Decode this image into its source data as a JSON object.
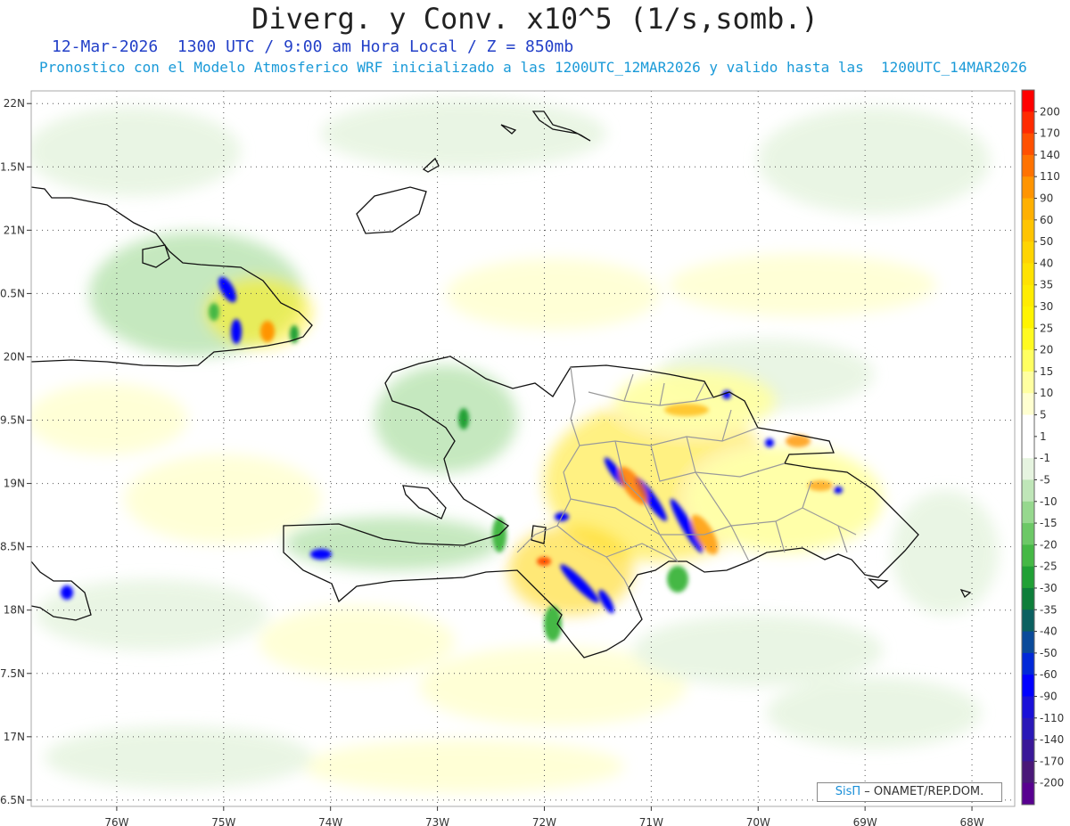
{
  "title": "Diverg. y Conv. x10^5 (1/s,somb.)",
  "subtitle_line1": "12-Mar-2026  1300 UTC / 9:00 am Hora Local / Z = 850mb",
  "subtitle_line2": "Pronostico con el Modelo Atmosferico WRF inicializado a las 1200UTC_12MAR2026 y valido hasta las  1200UTC_14MAR2026",
  "credit": {
    "brand": "SisΠ",
    "text": "– ONAMET/REP.DOM."
  },
  "chart_data": {
    "type": "heatmap",
    "lat_labels": [
      "22N",
      "1.5N",
      "21N",
      "0.5N",
      "20N",
      "9.5N",
      "19N",
      "8.5N",
      "18N",
      "7.5N",
      "17N",
      "6.5N"
    ],
    "lat_values": [
      22,
      21.5,
      21,
      20.5,
      20,
      19.5,
      19,
      18.5,
      18,
      17.5,
      17,
      16.5
    ],
    "lon_labels": [
      "76W",
      "75W",
      "74W",
      "73W",
      "72W",
      "71W",
      "70W",
      "69W",
      "68W"
    ],
    "lon_values": [
      -76,
      -75,
      -74,
      -73,
      -72,
      -71,
      -70,
      -69,
      -68
    ],
    "xlim": [
      -76.8,
      -67.6
    ],
    "ylim": [
      16.45,
      22.1
    ],
    "grid": true,
    "colorbar": {
      "labels": [
        "200",
        "170",
        "140",
        "110",
        "90",
        "60",
        "50",
        "40",
        "35",
        "30",
        "25",
        "20",
        "15",
        "10",
        "5",
        "1",
        "-1",
        "-5",
        "-10",
        "-15",
        "-20",
        "-25",
        "-30",
        "-35",
        "-40",
        "-50",
        "-60",
        "-90",
        "-110",
        "-140",
        "-170",
        "-200"
      ],
      "colors": [
        "#ff0000",
        "#ff2a00",
        "#ff5000",
        "#ff7200",
        "#ff9400",
        "#ffb000",
        "#ffc400",
        "#ffd400",
        "#ffe200",
        "#ffec00",
        "#fff400",
        "#fffa20",
        "#ffff60",
        "#ffffa0",
        "#ffffd0",
        "#ffffff",
        "#ffffff",
        "#e6f4e0",
        "#bfe6b8",
        "#96d88e",
        "#6cc866",
        "#45b845",
        "#20a035",
        "#0e7e3a",
        "#0b6060",
        "#0a4a9a",
        "#0028d8",
        "#0000ff",
        "#1a10d8",
        "#2a18b8",
        "#3a1898",
        "#4a1878",
        "#580090"
      ]
    },
    "features": [
      "Cuba (east)",
      "Haiti",
      "Dominican Republic",
      "Jamaica",
      "Great Inagua",
      "Turks and Caicos"
    ]
  }
}
